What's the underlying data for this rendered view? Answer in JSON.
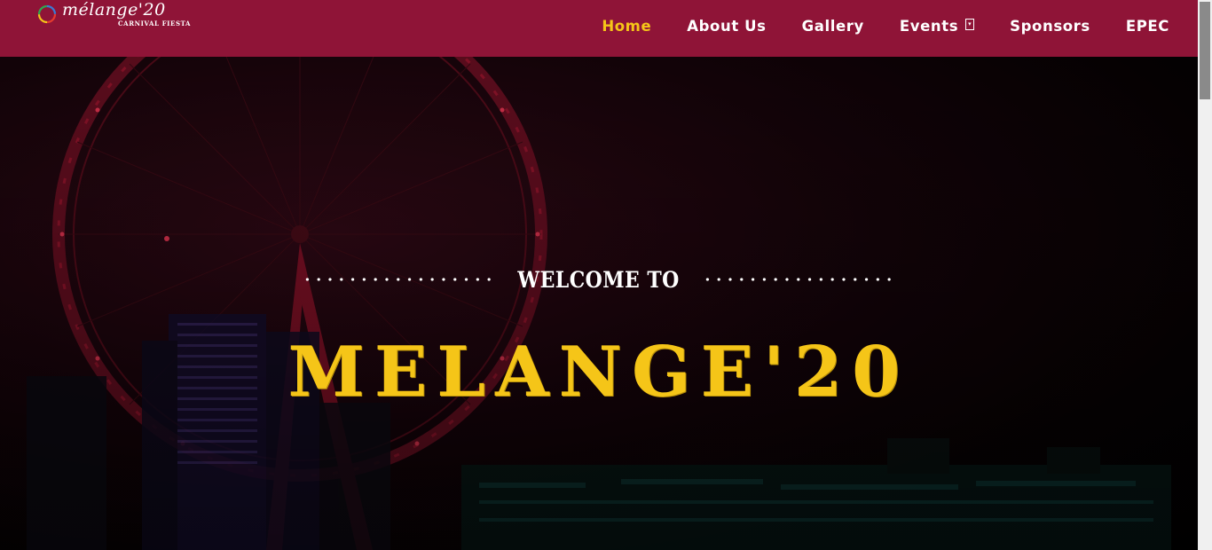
{
  "header": {
    "logo_word": "mélange'20",
    "logo_sub": "CARNIVAL FIESTA"
  },
  "nav": {
    "items": [
      {
        "label": "Home",
        "active": true
      },
      {
        "label": "About Us",
        "active": false
      },
      {
        "label": "Gallery",
        "active": false
      },
      {
        "label": "Events",
        "active": false,
        "dropdown": true
      },
      {
        "label": "Sponsors",
        "active": false
      },
      {
        "label": "EPEC",
        "active": false
      }
    ]
  },
  "hero": {
    "welcome": "WELCOME TO",
    "title": "MELANGE'20"
  },
  "colors": {
    "navbar": "#8f1437",
    "accent": "#f5c518",
    "nav_text": "#ffffff",
    "background": "#000000"
  },
  "icons": {
    "dropdown": "chevron-down-icon"
  }
}
